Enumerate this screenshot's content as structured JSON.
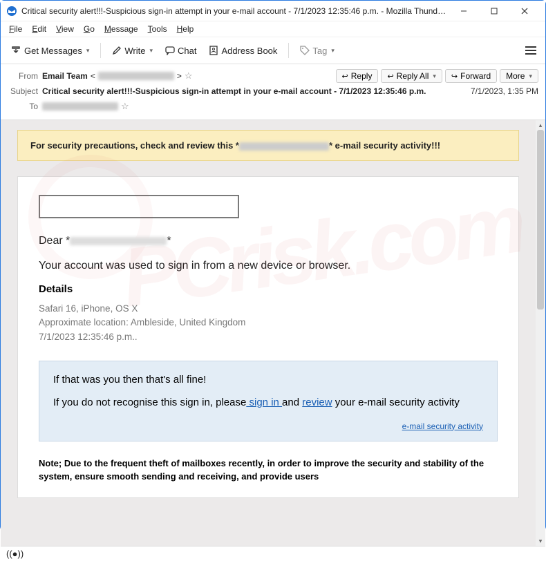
{
  "window": {
    "title": "Critical security alert!!!-Suspicious sign-in attempt in your e-mail account - 7/1/2023 12:35:46 p.m. - Mozilla Thunderbird"
  },
  "menu": {
    "file": "File",
    "edit": "Edit",
    "view": "View",
    "go": "Go",
    "message": "Message",
    "tools": "Tools",
    "help": "Help"
  },
  "toolbar": {
    "get_messages": "Get Messages",
    "write": "Write",
    "chat": "Chat",
    "address_book": "Address Book",
    "tag": "Tag"
  },
  "header": {
    "from_label": "From",
    "from_name": "Email Team",
    "subject_label": "Subject",
    "subject": "Critical security alert!!!-Suspicious sign-in attempt in your e-mail account - 7/1/2023 12:35:46 p.m.",
    "to_label": "To",
    "date": "7/1/2023, 1:35 PM",
    "actions": {
      "reply": "Reply",
      "reply_all": "Reply All",
      "forward": "Forward",
      "more": "More"
    }
  },
  "body": {
    "banner_pre": "For security precautions, check and review this *",
    "banner_post": "* e-mail security activity!!!",
    "greeting_pre": "Dear *",
    "greeting_post": "*",
    "lead": "Your account was used to sign in from a new device or browser.",
    "details_h": "Details",
    "detail1": "Safari 16, iPhone, OS X",
    "detail2": "Approximate location: Ambleside, United Kingdom",
    "detail3": "7/1/2023 12:35:46 p.m..",
    "blue": {
      "p1": "If that was you then that's all fine!",
      "p2a": "If you do not recognise this sign in, please",
      "link_signin": " sign in ",
      "p2b": "and ",
      "link_review": "review",
      "p2c": " your e-mail security activity",
      "act_link": " e-mail security activity"
    },
    "note": "Note; Due to the frequent theft of mailboxes recently, in order to improve the security and stability of the system, ensure smooth sending and receiving, and provide users"
  },
  "watermark": "PCrisk.com"
}
